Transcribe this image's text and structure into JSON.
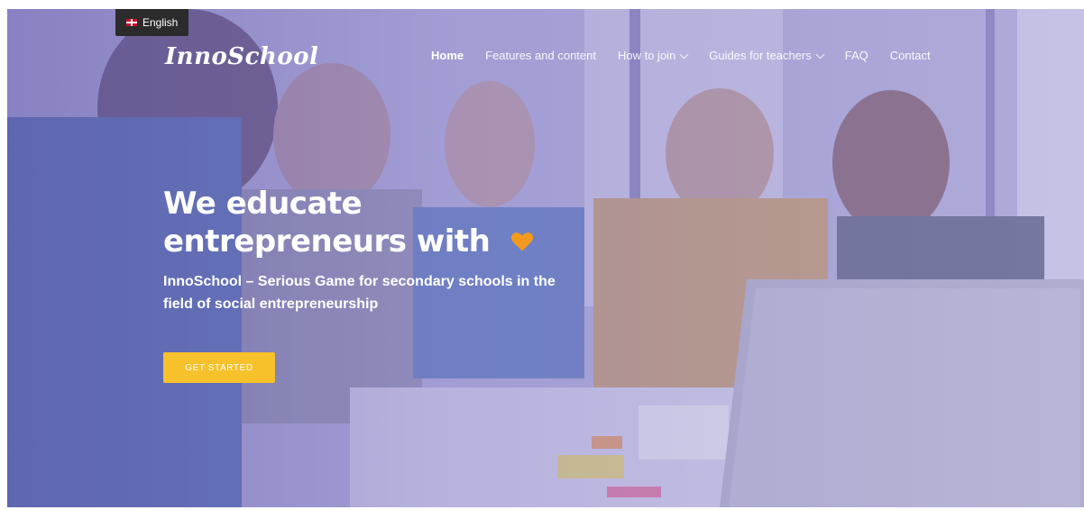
{
  "language_switcher": {
    "label": "English",
    "flag_icon": "uk-flag-icon"
  },
  "brand": {
    "logo_text": "InnoSchool"
  },
  "nav": {
    "items": [
      {
        "label": "Home",
        "active": true,
        "dropdown": false
      },
      {
        "label": "Features and content",
        "active": false,
        "dropdown": false
      },
      {
        "label": "How to join",
        "active": false,
        "dropdown": true
      },
      {
        "label": "Guides for teachers",
        "active": false,
        "dropdown": true
      },
      {
        "label": "FAQ",
        "active": false,
        "dropdown": false
      },
      {
        "label": "Contact",
        "active": false,
        "dropdown": false
      }
    ]
  },
  "hero": {
    "headline_line1": "We educate",
    "headline_line2": "entrepreneurs with",
    "heart_icon": "heart-icon",
    "subtitle": "InnoSchool – Serious Game for secondary schools in the field of social entrepreneurship",
    "cta_label": "GET STARTED"
  },
  "colors": {
    "accent": "#f6c12a",
    "heart": "#f39a1e",
    "overlay": "#6a62b5"
  }
}
